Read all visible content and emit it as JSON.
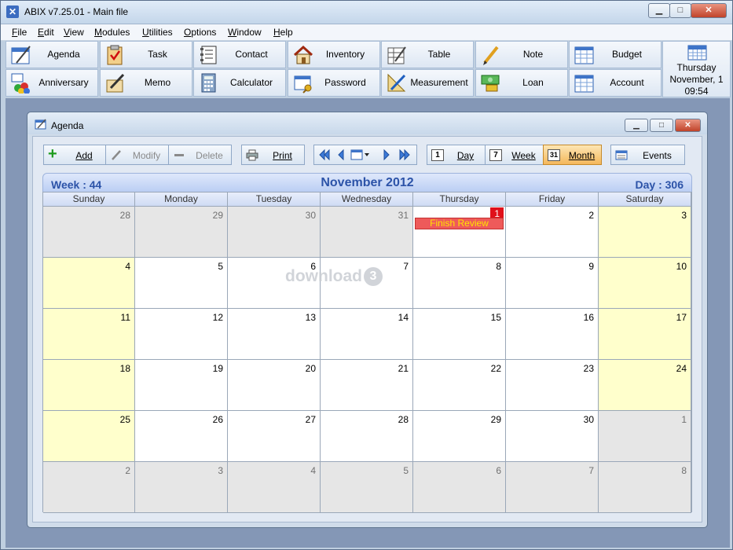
{
  "app": {
    "title": "ABIX v7.25.01  -  Main file",
    "window_controls": {
      "minimize": "▁",
      "maximize": "□",
      "close": "✕"
    }
  },
  "menu": [
    {
      "label": "File",
      "mnemonic": "F",
      "rest": "ile"
    },
    {
      "label": "Edit",
      "mnemonic": "E",
      "rest": "dit"
    },
    {
      "label": "View",
      "mnemonic": "V",
      "rest": "iew"
    },
    {
      "label": "Modules",
      "mnemonic": "M",
      "rest": "odules"
    },
    {
      "label": "Utilities",
      "mnemonic": "U",
      "rest": "tilities"
    },
    {
      "label": "Options",
      "mnemonic": "O",
      "rest": "ptions"
    },
    {
      "label": "Window",
      "mnemonic": "W",
      "rest": "indow"
    },
    {
      "label": "Help",
      "mnemonic": "H",
      "rest": "elp"
    }
  ],
  "modules": {
    "row1": [
      {
        "label": "Agenda",
        "icon": "agenda-icon"
      },
      {
        "label": "Task",
        "icon": "task-icon"
      },
      {
        "label": "Contact",
        "icon": "contact-icon"
      },
      {
        "label": "Inventory",
        "icon": "house-icon"
      },
      {
        "label": "Table",
        "icon": "table-icon"
      },
      {
        "label": "Note",
        "icon": "note-icon"
      },
      {
        "label": "Budget",
        "icon": "budget-icon"
      }
    ],
    "row2": [
      {
        "label": "Anniversary",
        "icon": "anniversary-icon"
      },
      {
        "label": "Memo",
        "icon": "memo-icon"
      },
      {
        "label": "Calculator",
        "icon": "calculator-icon"
      },
      {
        "label": "Password",
        "icon": "password-icon"
      },
      {
        "label": "Measurement",
        "icon": "measurement-icon"
      },
      {
        "label": "Loan",
        "icon": "loan-icon"
      },
      {
        "label": "Account",
        "icon": "account-icon"
      }
    ]
  },
  "clock": {
    "day": "Thursday",
    "date": "November, 1",
    "time": "09:54"
  },
  "agenda": {
    "title": "Agenda",
    "toolbar": {
      "add": "Add",
      "modify": "Modify",
      "delete": "Delete",
      "print": "Print",
      "day": "Day",
      "week": "Week",
      "month": "Month",
      "events": "Events",
      "day_icon_num": "1",
      "week_icon_num": "7",
      "month_icon_num": "31"
    },
    "header": {
      "week": "Week : 44",
      "month": "November 2012",
      "day": "Day : 306"
    },
    "weekdays": [
      "Sunday",
      "Monday",
      "Tuesday",
      "Wednesday",
      "Thursday",
      "Friday",
      "Saturday"
    ],
    "weeks": [
      [
        {
          "n": "28",
          "t": "other"
        },
        {
          "n": "29",
          "t": "other"
        },
        {
          "n": "30",
          "t": "other"
        },
        {
          "n": "31",
          "t": "other"
        },
        {
          "n": "1",
          "t": "today",
          "event": "Finish Review"
        },
        {
          "n": "2",
          "t": "normal"
        },
        {
          "n": "3",
          "t": "weekend"
        }
      ],
      [
        {
          "n": "4",
          "t": "weekend"
        },
        {
          "n": "5",
          "t": "normal"
        },
        {
          "n": "6",
          "t": "normal"
        },
        {
          "n": "7",
          "t": "normal"
        },
        {
          "n": "8",
          "t": "normal"
        },
        {
          "n": "9",
          "t": "normal"
        },
        {
          "n": "10",
          "t": "weekend"
        }
      ],
      [
        {
          "n": "11",
          "t": "weekend"
        },
        {
          "n": "12",
          "t": "normal"
        },
        {
          "n": "13",
          "t": "normal"
        },
        {
          "n": "14",
          "t": "normal"
        },
        {
          "n": "15",
          "t": "normal"
        },
        {
          "n": "16",
          "t": "normal"
        },
        {
          "n": "17",
          "t": "weekend"
        }
      ],
      [
        {
          "n": "18",
          "t": "weekend"
        },
        {
          "n": "19",
          "t": "normal"
        },
        {
          "n": "20",
          "t": "normal"
        },
        {
          "n": "21",
          "t": "normal"
        },
        {
          "n": "22",
          "t": "normal"
        },
        {
          "n": "23",
          "t": "normal"
        },
        {
          "n": "24",
          "t": "weekend"
        }
      ],
      [
        {
          "n": "25",
          "t": "weekend"
        },
        {
          "n": "26",
          "t": "normal"
        },
        {
          "n": "27",
          "t": "normal"
        },
        {
          "n": "28",
          "t": "normal"
        },
        {
          "n": "29",
          "t": "normal"
        },
        {
          "n": "30",
          "t": "normal"
        },
        {
          "n": "1",
          "t": "other"
        }
      ],
      [
        {
          "n": "2",
          "t": "other"
        },
        {
          "n": "3",
          "t": "other"
        },
        {
          "n": "4",
          "t": "other"
        },
        {
          "n": "5",
          "t": "other"
        },
        {
          "n": "6",
          "t": "other"
        },
        {
          "n": "7",
          "t": "other"
        },
        {
          "n": "8",
          "t": "other"
        }
      ]
    ]
  },
  "watermark": {
    "text": "download",
    "mark": "3"
  },
  "colors": {
    "accent": "#2c53a8",
    "weekend": "#ffffcc",
    "other_month": "#e6e6e6",
    "today": "#e0101a",
    "event_bg": "#ee5a5a",
    "event_text": "#ffe400"
  }
}
